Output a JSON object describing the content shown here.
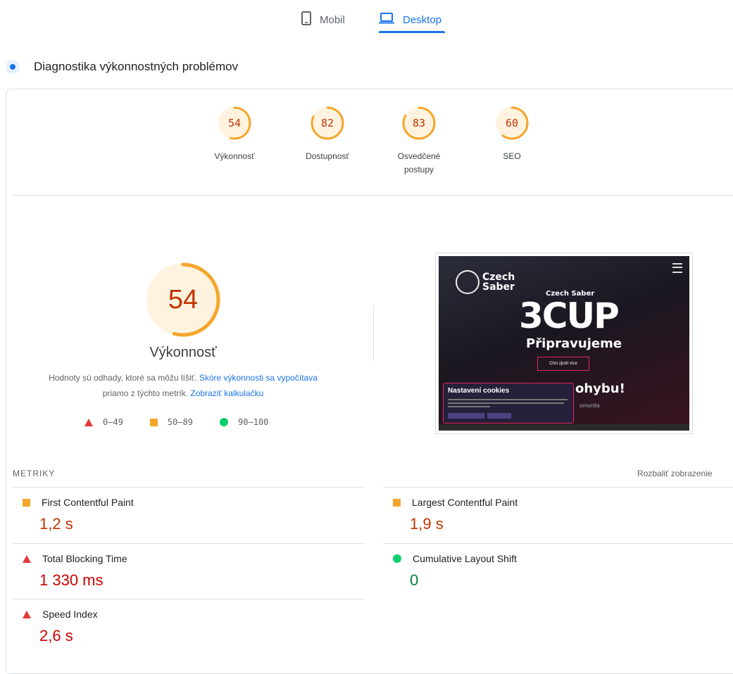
{
  "tabs": {
    "mobile_label": "Mobil",
    "desktop_label": "Desktop",
    "active": "desktop"
  },
  "section": {
    "title": "Diagnostika výkonnostných problémov"
  },
  "scores": [
    {
      "value": "54",
      "score": 54,
      "label": "Výkonnosť"
    },
    {
      "value": "82",
      "score": 82,
      "label": "Dostupnosť"
    },
    {
      "value": "83",
      "score": 83,
      "label": "Osvedčené postupy"
    },
    {
      "value": "60",
      "score": 60,
      "label": "SEO"
    }
  ],
  "performance": {
    "value": "54",
    "score": 54,
    "label": "Výkonnosť",
    "desc_text_1": "Hodnoty sú odhady, ktoré sa môžu líšiť.",
    "desc_link_1": "Skóre výkonnosti sa vypočítava",
    "desc_text_2": "priamo z týchto metrík.",
    "desc_link_2": "Zobraziť kalkulačku"
  },
  "legend": {
    "bad": "0–49",
    "average": "50–89",
    "good": "90–100"
  },
  "thumbnail": {
    "logo_line1": "Czech",
    "logo_line2": "Saber",
    "subtitle": "Czech Saber",
    "title": "3CUP",
    "tagline": "Připravujeme",
    "button": "Chci zjistit více",
    "headline_tail": "ohybu!",
    "community": "omunita",
    "cookie_title": "Nastavení cookies"
  },
  "metrics": {
    "header": "METRIKY",
    "expand_label": "Rozbaliť zobrazenie",
    "fcp": {
      "label": "First Contentful Paint",
      "value": "1,2 s",
      "status": "average"
    },
    "lcp": {
      "label": "Largest Contentful Paint",
      "value": "1,9 s",
      "status": "average"
    },
    "tbt": {
      "label": "Total Blocking Time",
      "value": "1 330 ms",
      "status": "bad"
    },
    "cls": {
      "label": "Cumulative Layout Shift",
      "value": "0",
      "status": "good"
    },
    "si": {
      "label": "Speed Index",
      "value": "2,6 s",
      "status": "bad"
    }
  },
  "colors": {
    "accent": "#1a73e8",
    "average": "#f4a62a",
    "average_text": "#c33300",
    "bad": "#e53935",
    "bad_text": "#cc0000",
    "good": "#0cce6b",
    "good_text": "#018642"
  }
}
